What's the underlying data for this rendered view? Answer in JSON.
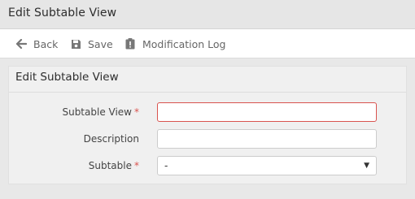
{
  "window": {
    "title": "Edit Subtable View"
  },
  "toolbar": {
    "back_label": "Back",
    "back_icon": "arrow-left-icon",
    "save_label": "Save",
    "save_icon": "floppy-disk-icon",
    "modlog_label": "Modification Log",
    "modlog_icon": "clipboard-alert-icon"
  },
  "panel": {
    "title": "Edit Subtable View",
    "fields": {
      "subtable_view": {
        "label": "Subtable View",
        "required_mark": "*",
        "value": "",
        "placeholder": ""
      },
      "description": {
        "label": "Description",
        "value": "",
        "placeholder": ""
      },
      "subtable": {
        "label": "Subtable",
        "required_mark": "*",
        "selected": "-"
      }
    }
  },
  "colors": {
    "required": "#d9534f",
    "invalid_border": "#d9534f",
    "toolbar_text": "#666666"
  }
}
